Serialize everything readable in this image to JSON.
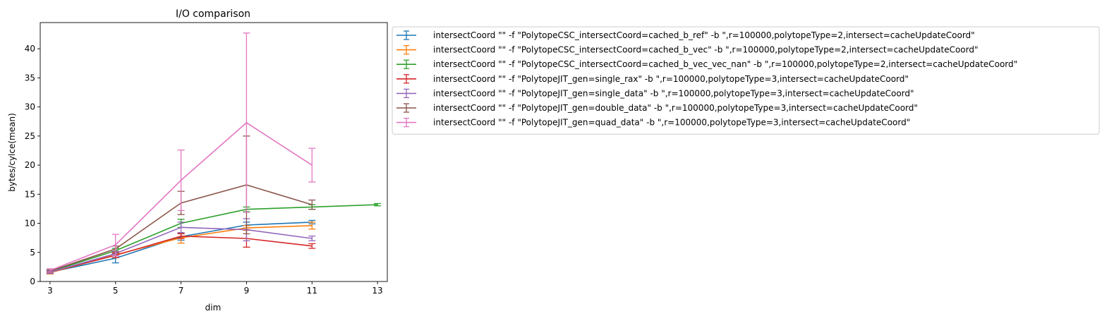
{
  "chart_data": {
    "type": "line",
    "title": "I/O comparison",
    "xlabel": "dim",
    "ylabel": "bytes/cylce(mean)",
    "xlim": [
      2.7,
      13.3
    ],
    "ylim": [
      0,
      44.5
    ],
    "xticks": [
      "3",
      "5",
      "7",
      "9",
      "11",
      "13"
    ],
    "yticks": [
      "0",
      "5",
      "10",
      "15",
      "20",
      "25",
      "30",
      "35",
      "40"
    ],
    "error_bars": true,
    "legend_position": "outside-right-top",
    "series": [
      {
        "name": "intersectCoord \"\" -f \"PolytopeCSC_intersectCoord=cached_b_ref\" -b \",r=100000,polytopeType=2,intersect=cacheUpdateCoord\"",
        "color": "#1f77b4",
        "x": [
          3,
          5,
          7,
          9,
          11
        ],
        "y": [
          1.6,
          4.0,
          7.7,
          9.7,
          10.2
        ],
        "err": [
          0.3,
          0.8,
          0.6,
          0.5,
          0.3
        ]
      },
      {
        "name": "intersectCoord \"\" -f \"PolytopeCSC_intersectCoord=cached_b_vec\" -b \",r=100000,polytopeType=2,intersect=cacheUpdateCoord\"",
        "color": "#ff7f0e",
        "x": [
          3,
          5,
          7,
          9,
          11
        ],
        "y": [
          1.5,
          4.6,
          7.5,
          9.2,
          9.6
        ],
        "err": [
          0.2,
          0.5,
          0.9,
          0.4,
          0.6
        ]
      },
      {
        "name": "intersectCoord \"\" -f \"PolytopeCSC_intersectCoord=cached_b_vec_vec_nan\" -b \",r=100000,polytopeType=2,intersect=cacheUpdateCoord\"",
        "color": "#2ca02c",
        "x": [
          3,
          5,
          7,
          9,
          11,
          13
        ],
        "y": [
          1.7,
          5.3,
          10.0,
          12.4,
          12.8,
          13.2
        ],
        "err": [
          0.2,
          0.4,
          0.7,
          0.4,
          0.4,
          0.2
        ]
      },
      {
        "name": "intersectCoord \"\" -f \"PolytopeJIT_gen=single_rax\" -b \",r=100000,polytopeType=3,intersect=cacheUpdateCoord\"",
        "color": "#d62728",
        "x": [
          3,
          5,
          7,
          9,
          11
        ],
        "y": [
          1.6,
          4.5,
          7.8,
          7.4,
          6.1
        ],
        "err": [
          0.2,
          0.4,
          0.4,
          1.5,
          0.4
        ]
      },
      {
        "name": "intersectCoord \"\" -f \"PolytopeJIT_gen=single_data\" -b \",r=100000,polytopeType=3,intersect=cacheUpdateCoord\"",
        "color": "#9467bd",
        "x": [
          3,
          5,
          7,
          9,
          11
        ],
        "y": [
          1.6,
          4.8,
          9.3,
          8.9,
          7.4
        ],
        "err": [
          0.2,
          0.4,
          0.9,
          1.9,
          0.4
        ]
      },
      {
        "name": "intersectCoord \"\" -f \"PolytopeJIT_gen=double_data\" -b \",r=100000,polytopeType=3,intersect=cacheUpdateCoord\"",
        "color": "#8c564b",
        "x": [
          3,
          5,
          7,
          9,
          11
        ],
        "y": [
          1.8,
          5.6,
          13.5,
          16.6,
          13.2
        ],
        "err": [
          0.2,
          0.5,
          2.0,
          8.4,
          0.8
        ]
      },
      {
        "name": "intersectCoord \"\" -f \"PolytopeJIT_gen=quad_data\" -b \",r=100000,polytopeType=3,intersect=cacheUpdateCoord\"",
        "color": "#e377c2",
        "x": [
          3,
          5,
          7,
          9,
          11
        ],
        "y": [
          1.9,
          6.3,
          17.4,
          27.3,
          20.0
        ],
        "err": [
          0.3,
          1.8,
          5.2,
          15.4,
          2.9
        ]
      }
    ]
  }
}
